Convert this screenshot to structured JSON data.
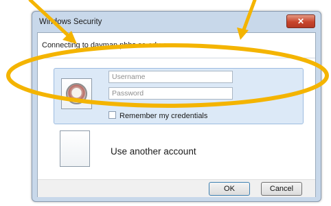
{
  "window": {
    "title": "Windows Security",
    "close_glyph": "✕"
  },
  "dialog": {
    "connecting_text": "Connecting to dayman.pbhs.sa.edu.au"
  },
  "credentials": {
    "username_placeholder": "Username",
    "password_placeholder": "Password",
    "remember_label": "Remember my credentials"
  },
  "another_account": {
    "label": "Use another account"
  },
  "buttons": {
    "ok": "OK",
    "cancel": "Cancel"
  },
  "annotation": {
    "color": "#f4b400",
    "icons": [
      "ellipse-highlight",
      "arrow-pointer-left",
      "arrow-pointer-right"
    ]
  }
}
